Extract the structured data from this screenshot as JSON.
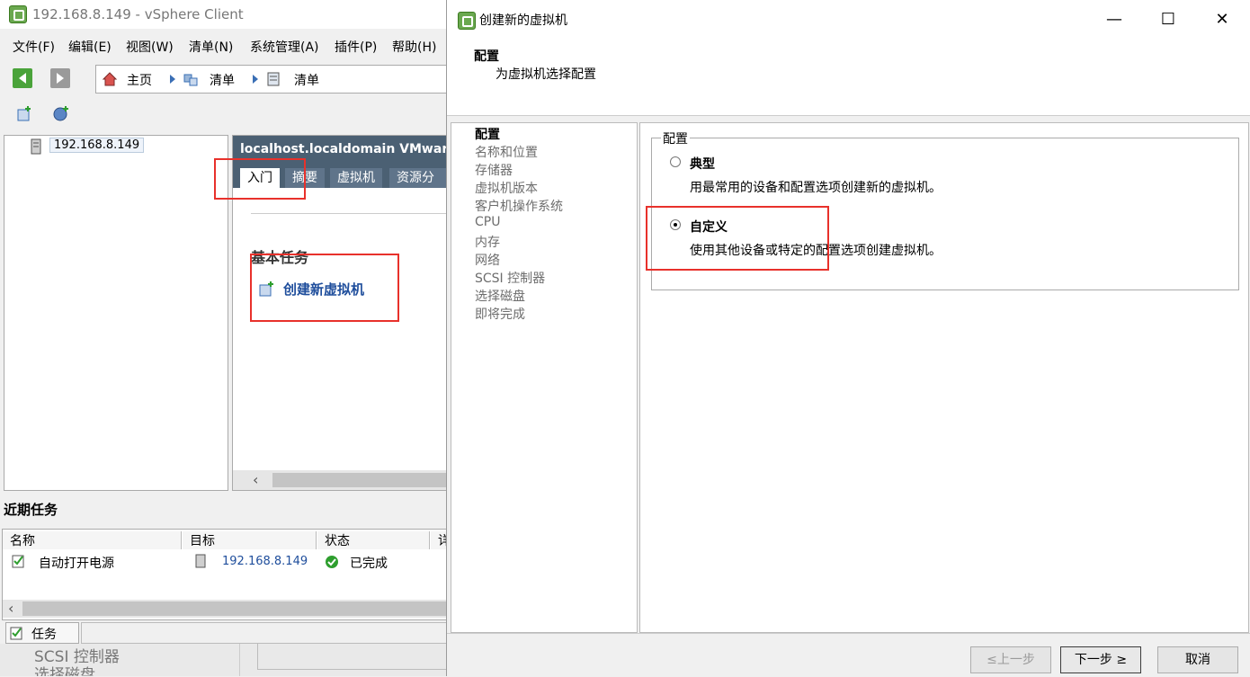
{
  "main_window": {
    "title": "192.168.8.149 - vSphere Client",
    "menu": [
      "文件(F)",
      "编辑(E)",
      "视图(W)",
      "清单(N)",
      "系统管理(A)",
      "插件(P)",
      "帮助(H)"
    ],
    "breadcrumb": [
      "主页",
      "清单",
      "清单"
    ],
    "tree_host": "192.168.8.149",
    "content_header": "localhost.localdomain VMware E",
    "tabs": [
      "入门",
      "摘要",
      "虚拟机",
      "资源分配"
    ],
    "basic_tasks_title": "基本任务",
    "create_vm_link": "创建新虚拟机",
    "recent_tasks": {
      "title": "近期任务",
      "columns": [
        "名称",
        "目标",
        "状态",
        "详"
      ],
      "rows": [
        {
          "name": "自动打开电源",
          "target": "192.168.8.149",
          "status": "已完成"
        }
      ]
    },
    "status_tab": "任务",
    "bottom_leak": [
      "SCSI 控制器",
      "选择磁盘"
    ]
  },
  "dialog": {
    "title": "创建新的虚拟机",
    "header_title": "配置",
    "header_subtitle": "为虚拟机选择配置",
    "steps": [
      "配置",
      "名称和位置",
      "存储器",
      "虚拟机版本",
      "客户机操作系统",
      "CPU",
      "内存",
      "网络",
      "SCSI 控制器",
      "选择磁盘",
      "即将完成"
    ],
    "group_label": "配置",
    "options": [
      {
        "label": "典型",
        "desc": "用最常用的设备和配置选项创建新的虚拟机。",
        "selected": false
      },
      {
        "label": "自定义",
        "desc": "使用其他设备或特定的配置选项创建虚拟机。",
        "selected": true
      }
    ],
    "buttons": {
      "back": "≤上一步",
      "next": "下一步 ≥",
      "cancel": "取消"
    }
  },
  "colors": {
    "highlight_box": "#e8312b",
    "link": "#1f4e9c",
    "header_bg": "#4b6073"
  }
}
